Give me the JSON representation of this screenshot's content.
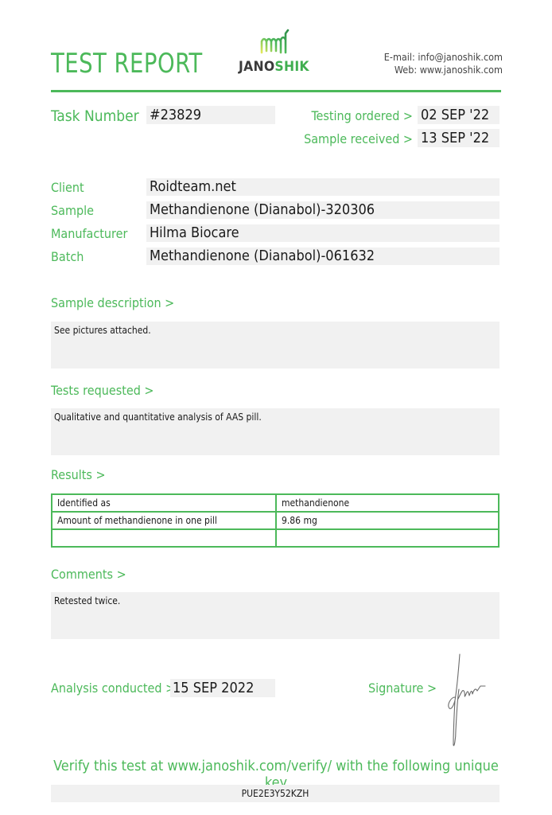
{
  "header": {
    "title": "TEST REPORT",
    "logo": {
      "name_dark": "JANO",
      "name_green": "SHIK",
      "icon": "janoshik-chart-logo-icon"
    },
    "email_line": "E-mail: info@janoshik.com",
    "web_line": "Web: www.janoshik.com"
  },
  "task": {
    "label": "Task Number",
    "value": "#23829"
  },
  "dates": {
    "testing_ordered_label": "Testing ordered  >",
    "testing_ordered_value": "02 SEP '22",
    "sample_received_label": "Sample received >",
    "sample_received_value": "13 SEP '22"
  },
  "info": [
    {
      "label": "Client",
      "value": "Roidteam.net"
    },
    {
      "label": "Sample",
      "value": "Methandienone (Dianabol)-320306"
    },
    {
      "label": "Manufacturer",
      "value": "Hilma Biocare"
    },
    {
      "label": "Batch",
      "value": "Methandienone (Dianabol)-061632"
    }
  ],
  "sample_description": {
    "heading": "Sample description >",
    "text": "See pictures attached."
  },
  "tests_requested": {
    "heading": "Tests requested >",
    "text": "Qualitative and quantitative analysis of AAS pill."
  },
  "results": {
    "heading": "Results >",
    "rows": [
      [
        "Identified as",
        "methandienone"
      ],
      [
        "Amount of methandienone in one pill",
        "9.86 mg"
      ],
      [
        "",
        ""
      ]
    ]
  },
  "comments": {
    "heading": "Comments >",
    "text": "Retested twice."
  },
  "analysis": {
    "label": "Analysis conducted >",
    "value": "15 SEP 2022"
  },
  "signature": {
    "label": "Signature >",
    "icon": "handwritten-signature-icon"
  },
  "verify": {
    "text": "Verify this test at www.janoshik.com/verify/ with the following unique key",
    "key": "PUE2E3Y52KZH"
  },
  "colors": {
    "accent": "#4cb95a",
    "field_bg": "#f1f1f1",
    "text": "#1a1a1a"
  }
}
